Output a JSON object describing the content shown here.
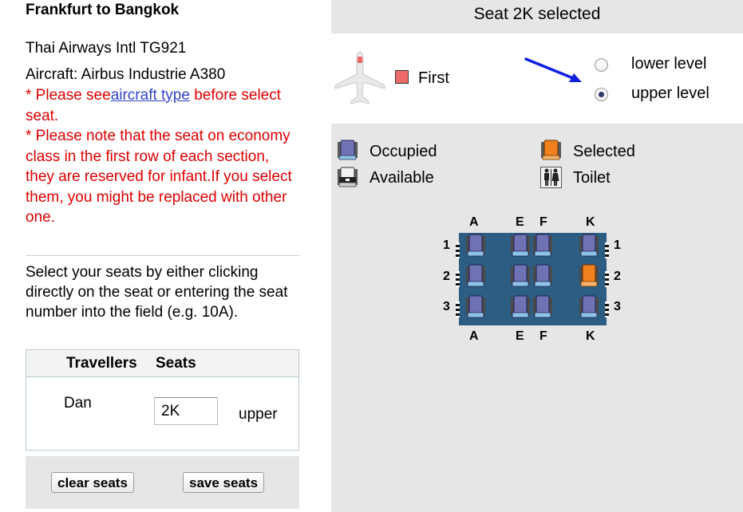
{
  "left": {
    "route_title": "Frankfurt to Bangkok",
    "flight": "Thai Airways Intl TG921",
    "aircraft": "Aircraft: Airbus Industrie A380",
    "notice_prefix": "* Please see",
    "notice_link": "aircraft type",
    "notice_suffix": " before select seat.",
    "notice_2": "* Please note that the seat on economy class in the first row of each section, they are reserved for infant.If you select them, you might be replaced with other one.",
    "instructions": "Select your seats by either clicking directly on the seat or entering the seat number into the field (e.g. 10A).",
    "table": {
      "header_travellers": "Travellers",
      "header_seats": "Seats",
      "traveller_name": "Dan",
      "seat_value": "2K",
      "seat_level": "upper"
    },
    "buttons": {
      "clear": "clear seats",
      "save": "save seats"
    }
  },
  "right": {
    "title": "Seat 2K selected",
    "cabin_class_label": "First",
    "cabin_class_color": "#ee6a6a",
    "levels": {
      "lower": "lower level",
      "upper": "upper level",
      "selected": "upper"
    },
    "legend": {
      "occupied": "Occupied",
      "available": "Available",
      "selected": "Selected",
      "toilet": "Toilet"
    },
    "seatmap": {
      "columns": [
        "A",
        "E",
        "F",
        "K"
      ],
      "rows": [
        "1",
        "2",
        "3"
      ],
      "seats": [
        {
          "id": "1A",
          "status": "occupied"
        },
        {
          "id": "1E",
          "status": "occupied"
        },
        {
          "id": "1F",
          "status": "occupied"
        },
        {
          "id": "1K",
          "status": "occupied"
        },
        {
          "id": "2A",
          "status": "occupied"
        },
        {
          "id": "2E",
          "status": "occupied"
        },
        {
          "id": "2F",
          "status": "occupied"
        },
        {
          "id": "2K",
          "status": "selected"
        },
        {
          "id": "3A",
          "status": "occupied"
        },
        {
          "id": "3E",
          "status": "occupied"
        },
        {
          "id": "3F",
          "status": "occupied"
        },
        {
          "id": "3K",
          "status": "occupied"
        }
      ],
      "colors": {
        "occupied": "#6f73b4",
        "selected": "#f0811e",
        "cabin": "#2c5d82"
      }
    }
  }
}
